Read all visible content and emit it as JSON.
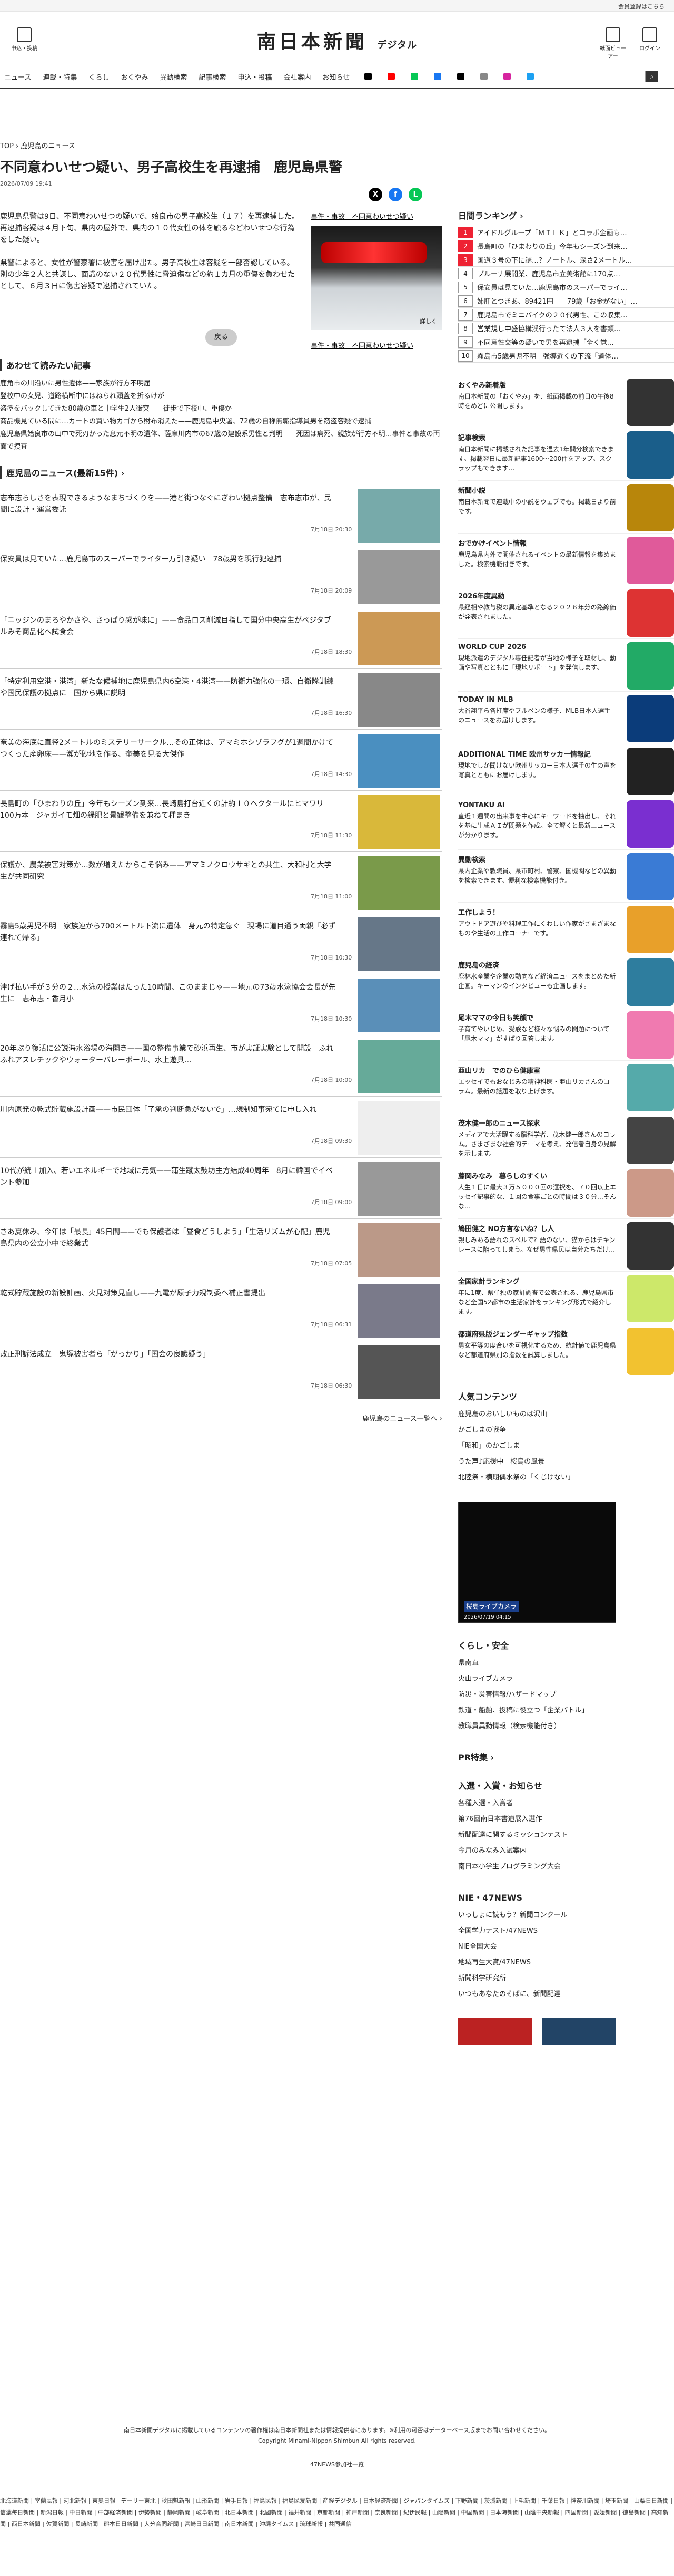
{
  "top_strip": {
    "member_text": "会員登録はこちら"
  },
  "header": {
    "post_label": "申込・投稿",
    "logo_main": "南日本新聞",
    "logo_sub": "デジタル",
    "viewer_label": "紙面ビューアー",
    "login_label": "ログイン"
  },
  "nav": {
    "items": [
      "ニュース",
      "連載・特集",
      "くらし",
      "おくやみ",
      "異動検索",
      "記事検索",
      "申込・投稿",
      "会社案内",
      "お知らせ"
    ],
    "search_placeholder": ""
  },
  "breadcrumb": {
    "top": "TOP",
    "sep": " › ",
    "current": "鹿児島のニュース"
  },
  "article": {
    "title": "不同意わいせつ疑い、男子高校生を再逮捕　鹿児島県警",
    "date": "2026/07/09 19:41",
    "paragraphs": [
      "鹿児島県警は9日、不同意わいせつの疑いで、姶良市の男子高校生（１７）を再逮捕した。再逮捕容疑は４月下旬、県内の屋外で、県内の１０代女性の体を触るなどわいせつな行為をした疑い。",
      "県警によると、女性が警察署に被害を届け出た。男子高校生は容疑を一部否認している。別の少年２人と共謀し、面識のない２０代男性に脅迫傷などの約１カ月の重傷を負わせたとして、６月３日に傷害容疑で逮捕されていた。"
    ],
    "tag_top": "事件・事故　不同意わいせつ疑い",
    "tag_bottom": "事件・事故　不同意わいせつ疑い",
    "photo_caption": "詳しく",
    "more_label": "戻る"
  },
  "related": {
    "heading": "あわせて読みたい記事",
    "items": [
      "鹿角市の川沿いに男性遺体——家族が行方不明届",
      "登校中の女児、道路横断中にはねられ頭蓋を折るけが",
      "盗塗をバックしてきた80歳の車と中学生2人衝突——徒歩で下校中、重傷か",
      "商品機見ている間に…カートの買い物カゴから財布消えた——鹿児島中央署、72歳の自称無職指導員男を窃盗容疑で逮捕",
      "鹿児島県姶良市の山中で死刃かった息元不明の遺体、薩摩川内市の67歳の建設系男性と判明——死因は病死、親族が行方不明…事件と事故の両面で捜査"
    ]
  },
  "news_list": {
    "heading": "鹿児島のニュース(最新15件) ›",
    "more": "鹿児島のニュース一覧へ ›",
    "items": [
      {
        "title": "志布志らしさを表現できるようなまちづくりを——港と街つなぐにぎわい拠点整備　志布志市が、民間に設計・運営委託",
        "time": "7月18日 20:30"
      },
      {
        "title": "保安員は見ていた…鹿児島市のスーパーでライター万引き疑い　78歳男を現行犯逮捕",
        "time": "7月18日 20:09"
      },
      {
        "title": "「ニッジンのまろやかさや、さっぱり感が味に」——食品ロス削減目指して国分中央高生がベジタブルみそ商品化へ試食会",
        "time": "7月18日 18:30"
      },
      {
        "title": "「特定利用空港・港湾」新たな候補地に鹿児島県内6空港・4港湾——防衛力強化の一環、自衛隊訓練や国民保護の拠点に　国から県に説明",
        "time": "7月18日 16:30"
      },
      {
        "title": "奄美の海底に直径2メートルのミステリーサークル…その正体は、アマミホシゾラフグが1週間かけてつくった産卵床——瀬が砂地を作る、奄美を見る大傑作",
        "time": "7月18日 14:30"
      },
      {
        "title": "長島町の「ひまわりの丘」今年もシーズン到来…長崎島打台近くの計約１０ヘクタールにヒマワリ100万本　ジャガイモ畑の緑肥と景観整備を兼ねて種まき",
        "time": "7月18日 11:30"
      },
      {
        "title": "保護か、農業被害対策か…数が増えたからこそ悩み——アマミノクロウサギとの共生、大和村と大学生が共同研究",
        "time": "7月18日 11:00"
      },
      {
        "title": "霧島5歳男児不明　家族連から700メートル下流に遺体　身元の特定急ぐ　現場に道目通う両親「必ず連れて帰る」",
        "time": "7月18日 10:30"
      },
      {
        "title": "津げ払い手が３分の２…水泳の授業はたった10時間、このままじゃ——地元の73歳水泳協会会長が先生に　志布志・香月小",
        "time": "7月18日 10:30"
      },
      {
        "title": "20年ぶり復活に公説海水浴場の海開き——国の整備事業で砂浜再生、市が実証実験として開設　ふれふれアスレチックやウォーターバレーボール、水上遊具…",
        "time": "7月18日 10:00"
      },
      {
        "title": "川内原発の乾式貯蔵施設計画——市民団体「了承の判断急がないで」…規制知事宛てに申し入れ",
        "time": "7月18日 09:30"
      },
      {
        "title": "10代が統＋加入、若いエネルギーで地域に元気——蒲生蹴太鼓坊主方結成40周年　8月に韓国でイベント参加",
        "time": "7月18日 09:00"
      },
      {
        "title": "さあ夏休み、今年は「最長」45日間——でも保護者は「昼食どうしよう」「生活リズムが心配」鹿児島県内の公立小中で終業式",
        "time": "7月18日 07:05"
      },
      {
        "title": "乾式貯蔵施設の新設計画、火見対策見直し——九電が原子力規制委へ補正書提出",
        "time": "7月18日 06:31"
      },
      {
        "title": "改正刑訴法成立　鬼塚被害者ら「がっかり」「国会の良識疑う」",
        "time": "7月18日 06:30"
      }
    ]
  },
  "ranking": {
    "heading": "日間ランキング ›",
    "items": [
      "アイドルグループ「ＭＩＬＫ」とコラボ企画も…",
      "長島町の「ひまわりの丘」今年もシーズン到来…",
      "国道３号の下に謎…？ノートル、深さ2メートル…",
      "ブルーナ展開業、鹿児島市立美術館に170点…",
      "保安員は見ていた…鹿児島市のスーパーでライ…",
      "姉肝とつきあ、89421円——79歳「お金がない」…",
      "鹿児島市でミニバイクの２０代男性、この収集…",
      "営業規し中盛協構渓行ったて法人３人を書類…",
      "不同意性交等の疑いで男を再逮捕「全く覚…",
      "霧島市5歳男児不明　強導近くの下流「道体…"
    ]
  },
  "sidebar_promos": [
    {
      "title": "おくやみ新着版",
      "desc": "南日本新聞の「おくやみ」を、紙面掲載の前日の午後8時をめどに公開します。",
      "color": "#333"
    },
    {
      "title": "記事検索",
      "desc": "南日本新聞に掲載された記事を過去1年間分検索できます。掲載翌日に最新記事1600〜200件をアップ。スクラップもできます…",
      "color": "#1a5e8a"
    },
    {
      "title": "新聞小説",
      "desc": "南日本新聞で連載中の小説をウェブでも。掲載日より前です。",
      "color": "#b8860b"
    },
    {
      "title": "おでかけイベント情報",
      "desc": "鹿児島県内外で開催されるイベントの最新情報を集めました。検索機能付きです。",
      "color": "#e05a9a"
    },
    {
      "title": "2026年度異動",
      "desc": "県経相や教与税の異定基準となる２０２６年分の路線価が発表されました。",
      "color": "#d33"
    },
    {
      "title": "WORLD CUP 2026",
      "desc": "現地派遣のデジタル専任記者が当地の様子を取材し、動画や写真とともに「現地リポート」を発信します。",
      "color": "#2a6"
    },
    {
      "title": "TODAY IN MLB",
      "desc": "大谷翔平ら各打席やプルペンの様子、MLB日本人選手のニュースをお届けします。",
      "color": "#0b3c7a"
    },
    {
      "title": "ADDITIONAL TIME 欧州サッカー情報記",
      "desc": "現地でしか聞けない欧州サッカー日本人選手の生の声を写真とともにお届けします。",
      "color": "#222"
    },
    {
      "title": "YONTAKU AI",
      "desc": "直近１週間の出来事を中心にキーワードを抽出し、それを基に生成ＡＩが問題を作成。全て解くと最新ニュースが分かります。",
      "color": "#7a2fd0"
    },
    {
      "title": "異動検索",
      "desc": "県内企業や教職員、県市町村、警察、国機関などの異動を検索できます。便利な検索機能付き。",
      "color": "#3a7bd5"
    },
    {
      "title": "工作しよう！",
      "desc": "アウトドア遊びや料理工作にくわしい作家がさまざまなものや生活の工作コーナーです。",
      "color": "#e8a02a"
    },
    {
      "title": "鹿児島の経済",
      "desc": "鹿林水産業や企業の動向など経済ニュースをまとめた新企画。キーマンのインタビューも企画します。",
      "color": "#2e7d9e"
    },
    {
      "title": "尾木ママの今日も笑顔で",
      "desc": "子育てやいじめ、受験など様々な悩みの問題について「尾木ママ」がすばり回答します。",
      "color": "#f07ab0"
    },
    {
      "title": "亜山リカ　でのひら健康室",
      "desc": "エッセイでもおなじみの精神科医・亜山リカさんのコラム。最新の話題を取り上げます。",
      "color": "#5aa"
    },
    {
      "title": "茂木健一郎のニュース探求",
      "desc": "メディアで大活躍する脳科学者、茂木健一郎さんのコラム。さまざまな社会的テーマを考え、発信者自身の見解を示します。",
      "color": "#444"
    },
    {
      "title": "藤岡みなみ　暮らしのすくい",
      "desc": "人生１日に最大３万５０００回の選択を、７０回以上エッセイ記事的な、１回の食事ごとの時間は３０分…そんな…",
      "color": "#c98"
    },
    {
      "title": "鳩田健之 NO方言ないね？し人",
      "desc": "親しみある語れのスペルで？語のない、猫からはチキンレースに陥ってしまう。なぜ男性県民は自分たちだけ…",
      "color": "#333"
    },
    {
      "title": "全国家計ランキング",
      "desc": "年に1度、県単独の家計調査で公表される、鹿児島県市など全国52都市の生活家計をランキング形式で紹介します。",
      "color": "#cde86a"
    },
    {
      "title": "都道府県版ジェンダーギャップ指数",
      "desc": "男女平等の度合いを可視化するため、統計値で鹿児島県など都道府県別の指数を試算しました。",
      "color": "#f2c230"
    }
  ],
  "popular": {
    "heading": "人気コンテンツ",
    "items": [
      "鹿児島のおいしいものは沢山",
      "かごしまの戦争",
      "「昭和」のかごしま",
      "うた声♪応援中　桜島の風景",
      "北陸祭・横期偶水祭の「くじけない」"
    ]
  },
  "live_camera": {
    "label": "桜島ライブカメラ",
    "time": "2026/07/19 04:15"
  },
  "life": {
    "heading": "くらし・安全",
    "items": [
      "県南直",
      "火山ライブカメラ",
      "防災・災害情報/ハザードマップ",
      "鉄道・船舶、投稿に役立つ「企業パトル」",
      "教職員異動情報（検索機能付き）"
    ]
  },
  "pr": {
    "heading": "PR特集 ›"
  },
  "entry": {
    "heading": "入選・入賞・お知らせ",
    "items": [
      "各種入選・入賞者",
      "第76回南日本書道展入選作",
      "新聞配達に関するミッションテスト",
      "今月のみなみ入試案内",
      "南日本小学生プログラミング大会"
    ]
  },
  "nie": {
    "heading": "NIE・47NEWS",
    "items": [
      "いっしょに読もう？新聞コンクール",
      "全国学力テスト/47NEWS",
      "NIE全国大会",
      "地域再生大賞/47NEWS",
      "新聞科学研究所",
      "いつもあなたのそばに、新聞配達"
    ]
  },
  "footer": {
    "notice": "南日本新聞デジタルに掲載しているコンテンツの著作権は南日本新聞社または情報提供者にあります。※利用の可否はデーターベース版までお問い合わせください。",
    "copyright": "Copyright Minami-Nippon Shimbun All rights reserved.",
    "links": "47NEWS参加社一覧",
    "partners": "北海道新聞 | 室蘭民報 | 河北新報 | 東奥日報 | デーリー東北 | 秋田魁新報 | 山形新聞 | 岩手日報 | 福島民報 | 福島民友新聞 | 産経デジタル | 日本経済新聞 | ジャパンタイムズ | 下野新聞 | 茨城新聞 | 上毛新聞 | 千葉日報 | 神奈川新聞 | 埼玉新聞 | 山梨日日新聞 | 信濃毎日新聞 | 新潟日報 | 中日新聞 | 中部経済新聞 | 伊勢新聞 | 静岡新聞 | 岐阜新聞 | 北日本新聞 | 北國新聞 | 福井新聞 | 京都新聞 | 神戸新聞 | 奈良新聞 | 紀伊民報 | 山陽新聞 | 中国新聞 | 日本海新聞 | 山陰中央新報 | 四国新聞 | 愛媛新聞 | 徳島新聞 | 高知新聞 | 西日本新聞 | 佐賀新聞 | 長崎新聞 | 熊本日日新聞 | 大分合同新聞 | 宮崎日日新聞 | 南日本新聞 | 沖縄タイムス | 琉球新報 | 共同通信"
  }
}
